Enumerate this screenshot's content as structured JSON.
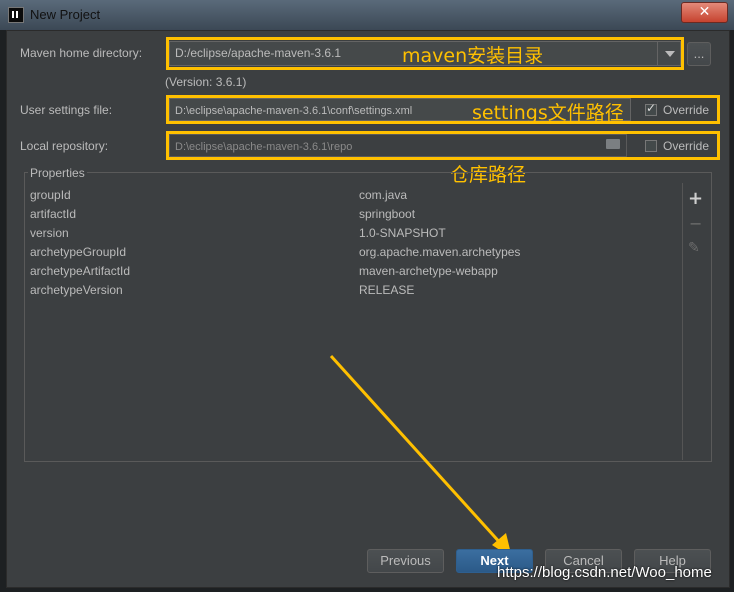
{
  "window": {
    "title": "New Project",
    "close_glyph": "✕"
  },
  "maven_home": {
    "label": "Maven home directory:",
    "value": "D:/eclipse/apache-maven-3.6.1",
    "version": "(Version: 3.6.1)",
    "browse_label": "...",
    "annotation": "maven安装目录"
  },
  "user_settings": {
    "label": "User settings file:",
    "value": "D:\\eclipse\\apache-maven-3.6.1\\conf\\settings.xml",
    "override_label": "Override",
    "override_checked": true,
    "annotation": "settings文件路径"
  },
  "local_repo": {
    "label": "Local repository:",
    "value": "D:\\eclipse\\apache-maven-3.6.1\\repo",
    "override_label": "Override",
    "override_checked": false,
    "annotation": "仓库路径"
  },
  "properties": {
    "title": "Properties",
    "rows": [
      {
        "key": "groupId",
        "value": "com.java"
      },
      {
        "key": "artifactId",
        "value": "springboot"
      },
      {
        "key": "version",
        "value": "1.0-SNAPSHOT"
      },
      {
        "key": "archetypeGroupId",
        "value": "org.apache.maven.archetypes"
      },
      {
        "key": "archetypeArtifactId",
        "value": "maven-archetype-webapp"
      },
      {
        "key": "archetypeVersion",
        "value": "RELEASE"
      }
    ],
    "add_glyph": "+",
    "remove_glyph": "−",
    "edit_glyph": "✎"
  },
  "buttons": {
    "previous": "Previous",
    "next": "Next",
    "cancel": "Cancel",
    "help": "Help"
  },
  "watermark": "https://blog.csdn.net/Woo_home",
  "colors": {
    "highlight": "#ffc000",
    "background": "#3c3f41",
    "primary_button": "#365880"
  }
}
